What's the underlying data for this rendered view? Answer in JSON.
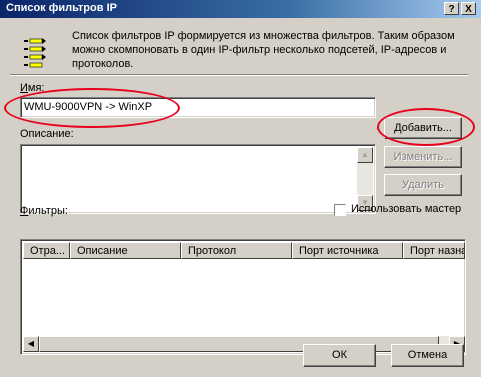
{
  "window": {
    "title": "Список фильтров IP",
    "help_button": "?",
    "close_button": "X"
  },
  "intro": {
    "description": "Список фильтров IP формируется из множества фильтров. Таким образом можно скомпоновать в один IP-фильтр несколько подсетей, IP-адресов и протоколов."
  },
  "name": {
    "label": "Имя:",
    "value": "WMU-9000VPN -> WinXP"
  },
  "description_field": {
    "label": "Описание:",
    "value": ""
  },
  "buttons": {
    "add": "Добавить...",
    "edit": "Изменить...",
    "delete": "Удалить",
    "ok": "ОК",
    "cancel": "Отмена"
  },
  "filters": {
    "label": "Фильтры:",
    "use_wizard_label": "Использовать мастер",
    "use_wizard_checked": false,
    "columns": [
      "Отра...",
      "Описание",
      "Протокол",
      "Порт источника",
      "Порт назна"
    ],
    "rows": []
  },
  "colors": {
    "dialog_bg": "#d4d0c8",
    "title_bar": "#0a246a",
    "annotation_red": "#e8001c"
  }
}
